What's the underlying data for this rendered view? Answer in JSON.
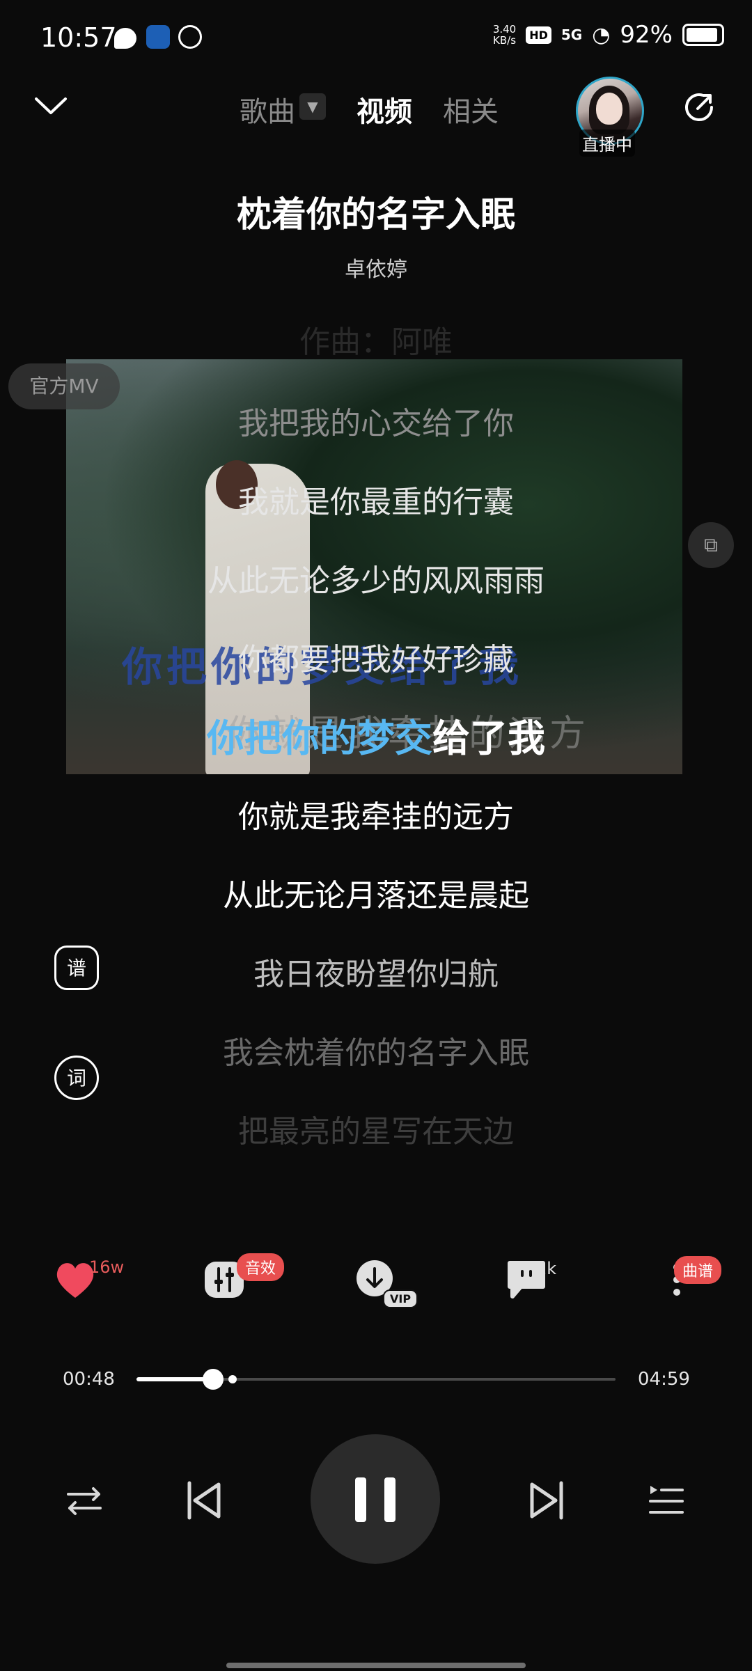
{
  "status": {
    "time": "10:57",
    "net_speed": "3.40",
    "net_unit": "KB/s",
    "hd": "HD",
    "signal": "5G",
    "battery": "92%"
  },
  "header": {
    "tabs": [
      "歌曲",
      "视频",
      "相关"
    ],
    "active_tab": "视频",
    "live_label": "直播中"
  },
  "song": {
    "title": "枕着你的名字入眠",
    "artist": "卓依婷"
  },
  "video": {
    "mv_badge": "官方MV",
    "subtitle_1": "你把你的梦交给了我",
    "subtitle_2": "你就是我牵挂的远方"
  },
  "lyrics": {
    "lines": [
      "作曲：阿唯",
      "我把我的心交给了你",
      "我就是你最重的行囊",
      "从此无论多少的风风雨雨",
      "你都要把我好好珍藏",
      "你把你的梦交给了我",
      "你就是我牵挂的远方",
      "从此无论月落还是晨起",
      "我日夜盼望你归航",
      "我会枕着你的名字入眠",
      "把最亮的星写在天边"
    ],
    "active_sung": "你把你的梦交",
    "active_rest": "给了我",
    "sheet_button": "谱",
    "lyric_button": "词"
  },
  "actions": {
    "like_count": "16w",
    "effects_badge": "音效",
    "download_badge": "VIP",
    "comment_count": "1k",
    "more_badge": "曲谱"
  },
  "player": {
    "current_time": "00:48",
    "total_time": "04:59",
    "progress": 0.16,
    "buffered": 0.2
  }
}
